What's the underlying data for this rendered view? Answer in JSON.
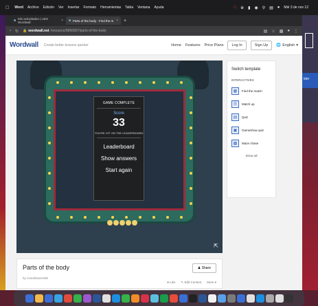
{
  "menubar": {
    "app": "Word",
    "items": [
      "Archivo",
      "Edición",
      "Ver",
      "Insertar",
      "Formato",
      "Herramientas",
      "Tabla",
      "Ventana",
      "Ayuda"
    ],
    "clock": "Mié 3 de nov 12"
  },
  "browser": {
    "tabs": [
      {
        "label": "Mis actividades | UDS Wordwall"
      },
      {
        "label": "Parts of the body - Find the m"
      }
    ],
    "new_tab": "+",
    "url_host": "wordwall.net",
    "url_path": "/resource/5866907/parts-of-the-body"
  },
  "header": {
    "logo": "Wordwall",
    "tagline": "Create better lessons quicker",
    "nav": [
      "Home",
      "Features",
      "Price Plans"
    ],
    "login": "Log In",
    "signup": "Sign Up",
    "language": "English"
  },
  "modal": {
    "title": "GAME COMPLETE",
    "score_label": "Score",
    "score": "33",
    "leaderboard_note": "YOU'RE 1ST ON THE LEADERBOARD",
    "buttons": [
      "Leaderboard",
      "Show answers",
      "Start again"
    ]
  },
  "sidebar": {
    "title": "Switch template",
    "section": "INTERACTIVES",
    "items": [
      {
        "label": "Find the match",
        "icon": "find-match-icon"
      },
      {
        "label": "Match up",
        "icon": "match-up-icon"
      },
      {
        "label": "Quiz",
        "icon": "quiz-icon"
      },
      {
        "label": "Gameshow quiz",
        "icon": "gameshow-icon"
      },
      {
        "label": "Maze chase",
        "icon": "maze-icon"
      }
    ],
    "show_all": "Show all"
  },
  "activity": {
    "title": "Parts of the body",
    "by_prefix": "by",
    "author": "Candelatorre85",
    "share": "Share",
    "like": "Like",
    "edit": "Edit Content",
    "more": "More"
  },
  "peek": {
    "label": "ider"
  }
}
